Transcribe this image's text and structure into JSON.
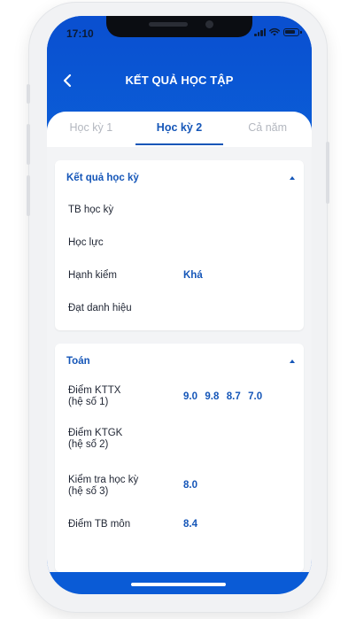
{
  "status_bar": {
    "time": "17:10"
  },
  "header": {
    "title": "KẾT QUẢ HỌC TẬP"
  },
  "tabs": [
    {
      "label": "Học kỳ 1",
      "active": false
    },
    {
      "label": "Học kỳ 2",
      "active": true
    },
    {
      "label": "Cả năm",
      "active": false
    }
  ],
  "semester_card": {
    "title": "Kết quả học kỳ",
    "rows": [
      {
        "label": "TB học kỳ",
        "value": ""
      },
      {
        "label": "Học lực",
        "value": ""
      },
      {
        "label": "Hạnh kiểm",
        "value": "Khá"
      },
      {
        "label": "Đạt danh hiệu",
        "value": ""
      }
    ]
  },
  "subject_card": {
    "title": "Toán",
    "rows": [
      {
        "label_line1": "Điểm KTTX",
        "label_line2": "(hệ số 1)",
        "value": "9.0  9.8  8.7  7.0"
      },
      {
        "label_line1": "Điểm KTGK",
        "label_line2": "(hệ số 2)",
        "value": ""
      },
      {
        "label_line1": "Kiểm tra học kỳ",
        "label_line2": "(hệ số 3)",
        "value": "8.0"
      },
      {
        "label_line1": "Điểm TB môn",
        "label_line2": "",
        "value": "8.4"
      }
    ]
  },
  "colors": {
    "primary": "#0b5fd8",
    "accent_text": "#1556b8",
    "background": "#f3f4f6"
  }
}
